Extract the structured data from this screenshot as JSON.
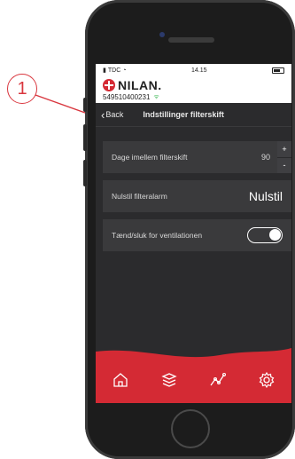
{
  "callout": {
    "number": "1"
  },
  "status": {
    "carrier": "TDC",
    "time": "14.15"
  },
  "brand": {
    "logo_text": "NILAN.",
    "serial": "549510400231"
  },
  "nav": {
    "back_label": "Back",
    "title": "Indstillinger filterskift"
  },
  "rows": {
    "days": {
      "label": "Dage imellem filterskift",
      "value": "90",
      "plus": "+",
      "minus": "-"
    },
    "reset": {
      "label": "Nulstil filteralarm",
      "button": "Nulstil"
    },
    "vent": {
      "label": "Tænd/sluk for ventilationen",
      "toggle_on": true
    }
  },
  "colors": {
    "accent": "#d42a34",
    "screen_bg": "#2b2b2d",
    "row_bg": "#3a3a3c"
  },
  "tabs": [
    {
      "icon": "home-icon"
    },
    {
      "icon": "layers-icon"
    },
    {
      "icon": "graph-icon"
    },
    {
      "icon": "gear-icon"
    }
  ]
}
